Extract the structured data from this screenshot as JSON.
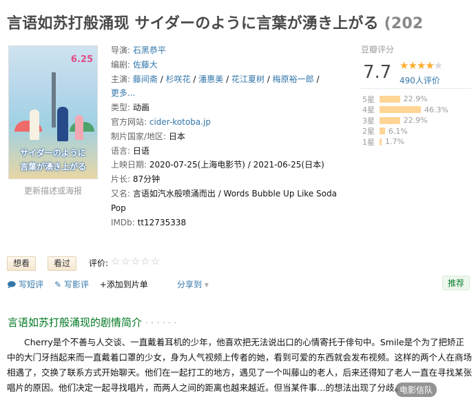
{
  "title": "言语如苏打般涌现 サイダーのように言葉が湧き上がる",
  "year": "(202",
  "poster": {
    "date": "6.25",
    "tagline1": "サイダーのように",
    "tagline2": "言葉が湧き上がる",
    "update_link": "更新描述或海报"
  },
  "info": {
    "director_label": "导演:",
    "director": "石黑恭平",
    "writer_label": "编剧:",
    "writer": "佐藤大",
    "cast_label": "主演:",
    "cast": [
      "藤间斋",
      "杉咲花",
      "潘惠美",
      "花江夏树",
      "梅原裕一郎"
    ],
    "cast_more": "更多...",
    "genre_label": "类型:",
    "genre": "动画",
    "site_label": "官方网站:",
    "site": "cider-kotoba.jp",
    "country_label": "制片国家/地区:",
    "country": "日本",
    "language_label": "语言:",
    "language": "日语",
    "release_label": "上映日期:",
    "release": "2020-07-25(上海电影节) / 2021-06-25(日本)",
    "runtime_label": "片长:",
    "runtime": "87分钟",
    "aka_label": "又名:",
    "aka": "言语如汽水般喷涌而出 / Words Bubble Up Like Soda Pop",
    "imdb_label": "IMDb:",
    "imdb": "tt12735338"
  },
  "rating": {
    "label": "豆瓣评分",
    "score": "7.7",
    "stars_filled": 4,
    "count": "490人评价",
    "distribution": [
      {
        "level": "5星",
        "pct": "22.9%",
        "value": 22.9
      },
      {
        "level": "4星",
        "pct": "46.3%",
        "value": 46.3
      },
      {
        "level": "3星",
        "pct": "22.9%",
        "value": 22.9
      },
      {
        "level": "2星",
        "pct": "6.1%",
        "value": 6.1
      },
      {
        "level": "1星",
        "pct": "1.7%",
        "value": 1.7
      }
    ]
  },
  "buttons": {
    "want": "想看",
    "seen": "看过",
    "rate_label": "评价:"
  },
  "actions": {
    "short_review": "写短评",
    "review": "写影评",
    "add_list": "+添加到片单",
    "share": "分享到",
    "recommend": "推荐"
  },
  "synopsis": {
    "title": "言语如苏打般涌现的剧情简介",
    "dots": "· · · · · ·",
    "text": "Cherry是个不善与人交谈、一直戴着耳机的少年，他喜欢把无法说出口的心情寄托于俳句中。Smile是个为了把矫正中的大门牙挡起来而一直戴着口罩的少女，身为人气视频上传者的她，看到可爱的东西就会发布视频。这样的两个人在商场相遇了，交换了联系方式开始聊天。他们在一起打工的地方，遇见了一个叫藤山的老人，后来还得知了老人一直在寻找某张唱片的原因。他们决定一起寻找唱片，而两人之间的距离也越来越近。但当某件事…的想法出现了分歧。"
  },
  "watermark": "电影信队"
}
